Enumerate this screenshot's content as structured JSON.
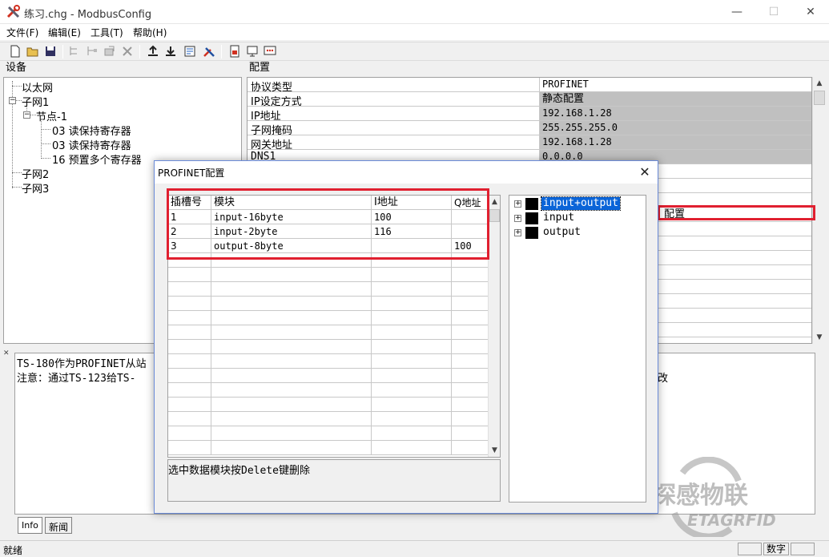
{
  "window": {
    "title": "练习.chg - ModbusConfig",
    "minimize": "—",
    "maximize": "☐",
    "close": "✕"
  },
  "menu": [
    "文件(F)",
    "编辑(E)",
    "工具(T)",
    "帮助(H)"
  ],
  "panes": {
    "device_header": "设备",
    "config_header": "配置"
  },
  "device_tree": {
    "ethernet": "以太网",
    "subnet1": "子网1",
    "node1": "节点-1",
    "cmd1": "03 读保持寄存器",
    "cmd2": "03 读保持寄存器",
    "cmd3": "16 预置多个寄存器",
    "subnet2": "子网2",
    "subnet3": "子网3"
  },
  "config": {
    "rows": [
      {
        "key": "协议类型",
        "value": "PROFINET"
      },
      {
        "key": "IP设定方式",
        "value": "静态配置"
      },
      {
        "key": "IP地址",
        "value": "192.168.1.28"
      },
      {
        "key": "子网掩码",
        "value": "255.255.255.0"
      },
      {
        "key": "网关地址",
        "value": "192.168.1.28"
      },
      {
        "key": "DNS1",
        "value": "0.0.0.0"
      }
    ],
    "module_config_value": "配置"
  },
  "info": {
    "line1": "TS-180作为PROFINET从站",
    "line2": "注意：通过TS-123给TS-",
    "line2_tail": "改"
  },
  "tabs": [
    "Info",
    "新闻"
  ],
  "status": {
    "ready": "就绪",
    "numlock": "数字"
  },
  "dialog": {
    "title": "PROFINET配置",
    "close": "✕",
    "columns": [
      "插槽号",
      "模块",
      "I地址",
      "Q地址"
    ],
    "rows": [
      {
        "slot": "1",
        "module": "input-16byte",
        "i_addr": "100",
        "q_addr": ""
      },
      {
        "slot": "2",
        "module": "input-2byte",
        "i_addr": "116",
        "q_addr": ""
      },
      {
        "slot": "3",
        "module": "output-8byte",
        "i_addr": "",
        "q_addr": "100"
      }
    ],
    "hint": "选中数据模块按Delete键删除",
    "modules": [
      {
        "label": "input+output",
        "selected": true
      },
      {
        "label": "input",
        "selected": false
      },
      {
        "label": "output",
        "selected": false
      }
    ]
  },
  "watermark": {
    "cn": "探感物联",
    "en": "ETAGRFID"
  },
  "colors": {
    "highlight_red": "#e02030",
    "selection_blue": "#0a64d8",
    "readonly_gray": "#c0c0c0"
  }
}
